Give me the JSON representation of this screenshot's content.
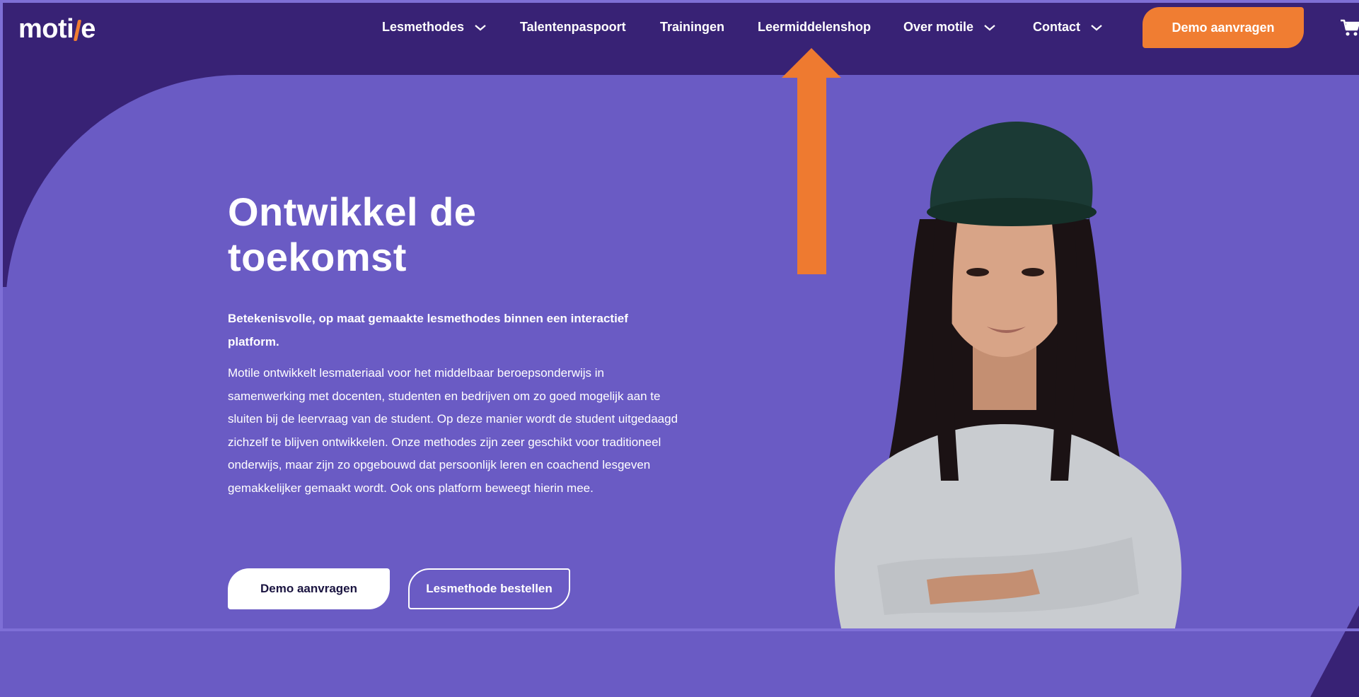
{
  "brand": {
    "name_prefix": "moti",
    "name_suffix": "e",
    "accent": "#f07d32",
    "navy": "#382275",
    "hero_bg": "#6a5bc4"
  },
  "nav": {
    "items": [
      {
        "label": "Lesmethodes",
        "dropdown": true
      },
      {
        "label": "Talentenpaspoort",
        "dropdown": false
      },
      {
        "label": "Trainingen",
        "dropdown": false
      },
      {
        "label": "Leermiddelenshop",
        "dropdown": false
      },
      {
        "label": "Over motile",
        "dropdown": true
      },
      {
        "label": "Contact",
        "dropdown": true
      }
    ],
    "cta_label": "Demo aanvragen",
    "cart_icon": "cart-icon"
  },
  "hero": {
    "title_line1": "Ontwikkel de",
    "title_line2": "toekomst",
    "lead": "Betekenisvolle, op maat gemaakte lesmethodes binnen een interactief platform.",
    "body": "Motile ontwikkelt lesmateriaal voor het middelbaar beroepsonderwijs in samenwerking met docenten, studenten en bedrijven om zo goed mogelijk aan te sluiten bij de leervraag van de student. Op deze manier wordt de student uitgedaagd zichzelf te blijven ontwikkelen. Onze methodes zijn zeer geschikt voor traditioneel onderwijs, maar zijn zo opgebouwd dat persoonlijk leren en coachend lesgeven gemakkelijker gemaakt wordt. Ook ons platform beweegt hierin mee.",
    "primary_button": "Demo aanvragen",
    "secondary_button": "Lesmethode bestellen"
  },
  "annotation": {
    "arrow_color": "#ee7a30",
    "points_to": "Leermiddelenshop"
  }
}
